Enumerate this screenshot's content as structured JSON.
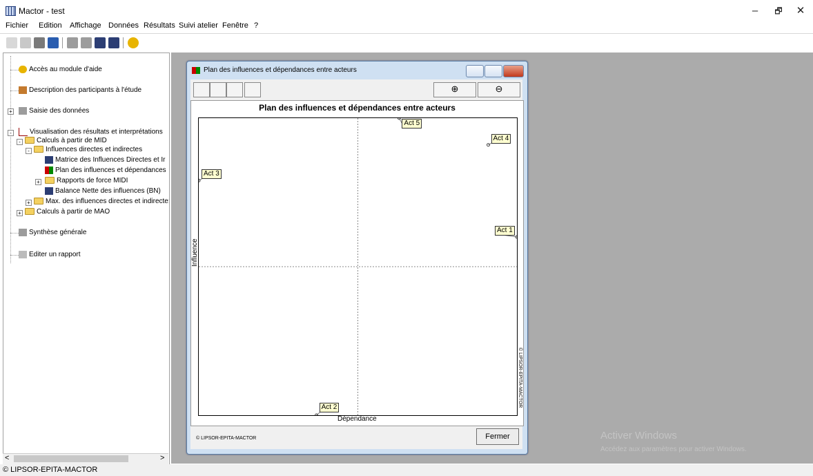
{
  "window": {
    "title": "Mactor - test",
    "controls": {
      "minimize": "–",
      "maximize": "🗗",
      "close": "✕"
    }
  },
  "menu": [
    "Fichier",
    "Edition",
    "Affichage",
    "Données",
    "Résultats",
    "Suivi atelier",
    "Fenêtre",
    "?"
  ],
  "toolbar_icons": [
    "new-icon",
    "open-icon",
    "print-icon",
    "save-icon",
    "data-icon",
    "data-icon-2",
    "grid-icon",
    "grid-icon-2",
    "help-icon"
  ],
  "tree": {
    "help": "Accès au module d'aide",
    "participants": "Description des participants à l'étude",
    "data_entry": "Saisie des données",
    "visualisation": "Visualisation des résultats et interprétations",
    "mid": "Calculs à partir de MID",
    "influences": "Influences directes et indirectes",
    "matrix": "Matrice des Influences Directes et Ir",
    "plan": "Plan des influences et dépendances",
    "force": "Rapports de force MIDI",
    "balance": "Balance Nette des influences (BN)",
    "max": "Max. des influences directes et indirecte:",
    "mao": "Calculs à partir de MAO",
    "synthesis": "Synthèse générale",
    "report": "Editer un rapport"
  },
  "dialog": {
    "title": "Plan des influences et dépendances entre acteurs",
    "zoom_in": "⊕",
    "zoom_out": "⊖",
    "close_label": "Fermer",
    "footer": "© LIPSOR-EPITA-MACTOR",
    "side_copyright": "© LIPSOR-EPITA-MACTOR"
  },
  "chart_data": {
    "type": "scatter",
    "title": "Plan des influences et dépendances entre acteurs",
    "xlabel": "Dépendance",
    "ylabel": "Influence",
    "points": [
      {
        "label": "Act 1",
        "x": 1.0,
        "y": 0.6
      },
      {
        "label": "Act 2",
        "x": 0.37,
        "y": 0.0
      },
      {
        "label": "Act 3",
        "x": 0.0,
        "y": 0.79
      },
      {
        "label": "Act 4",
        "x": 0.91,
        "y": 0.91
      },
      {
        "label": "Act 5",
        "x": 0.63,
        "y": 1.0
      }
    ]
  },
  "statusbar": "© LIPSOR-EPITA-MACTOR",
  "watermark": {
    "title": "Activer Windows",
    "subtitle": "Accédez aux paramètres pour activer Windows."
  }
}
